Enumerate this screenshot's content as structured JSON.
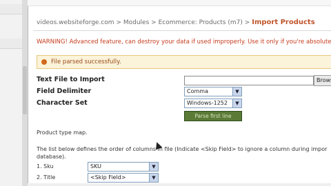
{
  "breadcrumb": {
    "site": "videos.websiteforge.com",
    "sep": ">",
    "modules": "Modules",
    "ecommerce": "Ecommerce: Products (m7)",
    "current": "Import Products"
  },
  "warning_text": "WARNING! Advanced feature, can destroy your data if used improperly. Use it only if you're absolutely su",
  "message": {
    "text": "File parsed successfully.",
    "color": "#d2691e"
  },
  "form": {
    "file_label": "Text File to Import",
    "file_value": "",
    "browse_label": "Brows",
    "delimiter_label": "Field Delimiter",
    "delimiter_value": "Comma",
    "charset_label": "Character Set",
    "charset_value": "Windows-1252",
    "parse_button": "Parse first line"
  },
  "product_type_map_label": "Product type map.",
  "instructions_line1": "The list below defines the order of columns in file (Indicate <Skip Field> to ignore a column during impor",
  "instructions_line2": "database).",
  "mappings": [
    {
      "label": "1. Sku",
      "value": "SKU"
    },
    {
      "label": "2. Title",
      "value": "<Skip Field>"
    }
  ],
  "colors": {
    "accent": "#c0542a",
    "warning": "#c43a1c",
    "button_bg": "#5a7a36"
  }
}
